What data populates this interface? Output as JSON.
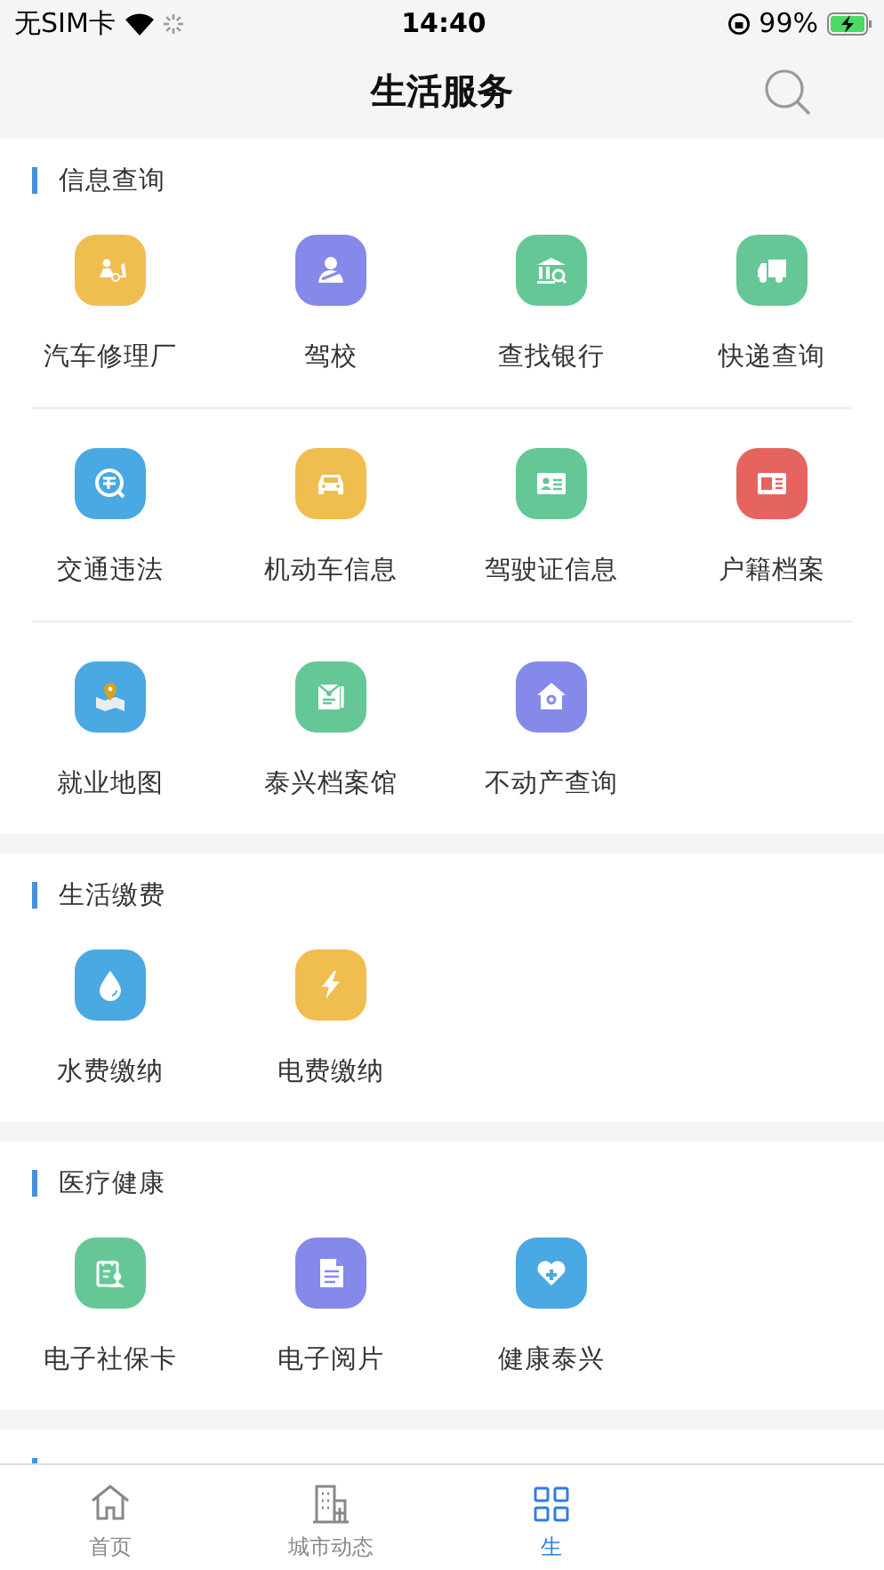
{
  "status_bar": {
    "carrier": "无SIM卡",
    "time": "14:40",
    "battery": "99%"
  },
  "nav": {
    "title": "生活服务"
  },
  "sections": [
    {
      "title": "信息查询",
      "cut_off": false,
      "items": [
        {
          "label": "汽车修理厂"
        },
        {
          "label": "驾校"
        },
        {
          "label": "查找银行"
        },
        {
          "label": "快递查询"
        },
        {
          "label": "交通违法"
        },
        {
          "label": "机动车信息"
        },
        {
          "label": "驾驶证信息"
        },
        {
          "label": "户籍档案"
        },
        {
          "label": "就业地图"
        },
        {
          "label": "泰兴档案馆"
        },
        {
          "label": "不动产查询"
        }
      ]
    },
    {
      "title": "生活缴费",
      "cut_off": false,
      "items": [
        {
          "label": "水费缴纳"
        },
        {
          "label": "电费缴纳"
        }
      ]
    },
    {
      "title": "医疗健康",
      "cut_off": false,
      "items": [
        {
          "label": "电子社保卡"
        },
        {
          "label": "电子阅片"
        },
        {
          "label": "健康泰兴"
        }
      ]
    },
    {
      "cut_off": true
    }
  ],
  "tabs": [
    {
      "label": "首页",
      "selected": false
    },
    {
      "label": "城市动态",
      "selected": false
    },
    {
      "label": "生",
      "selected": true
    }
  ]
}
